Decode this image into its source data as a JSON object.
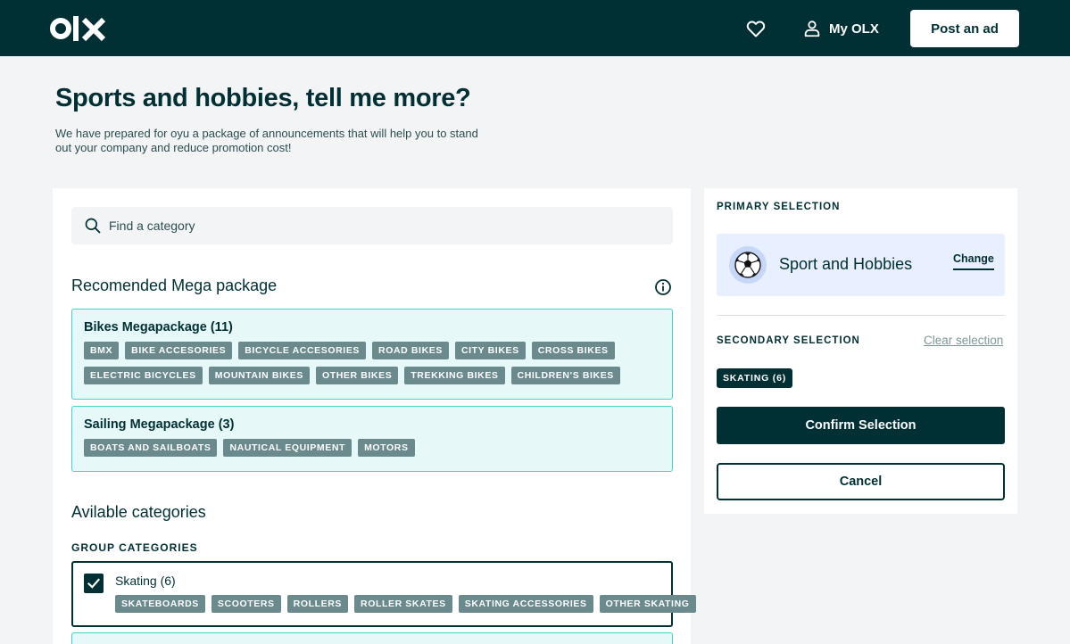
{
  "header": {
    "logo_text": "olx",
    "my_olx_label": "My OLX",
    "post_ad_label": "Post an ad"
  },
  "page": {
    "title": "Sports and hobbies, tell me more?",
    "subtitle": "We have prepared for oyu a package of announcements that will help you to stand out your company and reduce promotion cost!"
  },
  "search": {
    "placeholder": "Find a category"
  },
  "recommended": {
    "title": "Recomended Mega package",
    "packages": [
      {
        "title": "Bikes Megapackage (11)",
        "tags": [
          "BMX",
          "BIKE ACCESORIES",
          "BICYCLE ACCESORIES",
          "ROAD BIKES",
          "CITY BIKES",
          "CROSS BIKES",
          "ELECTRIC BICYCLES",
          "MOUNTAIN BIKES",
          "OTHER BIKES",
          "TREKKING BIKES",
          "CHILDREN'S BIKES"
        ]
      },
      {
        "title": "Sailing Megapackage (3)",
        "tags": [
          "BOATS AND SAILBOATS",
          "NAUTICAL EQUIPMENT",
          "MOTORS"
        ]
      }
    ]
  },
  "available": {
    "title": "Avilable categories",
    "group_label": "GROUP CATEGORIES",
    "groups": [
      {
        "name": "Skating (6)",
        "checked": true,
        "tags": [
          "SKATEBOARDS",
          "SCOOTERS",
          "ROLLERS",
          "ROLLER SKATES",
          "SKATING ACCESSORIES",
          "OTHER SKATING"
        ]
      }
    ]
  },
  "selection": {
    "primary_label": "PRIMARY SELECTION",
    "primary_name": "Sport and Hobbies",
    "change_label": "Change",
    "secondary_label": "SECONDARY SELECTION",
    "clear_label": "Clear selection",
    "selected_chip": "SKATING (6)",
    "confirm_label": "Confirm Selection",
    "cancel_label": "Cancel"
  },
  "colors": {
    "brand_dark": "#002f34",
    "package_bg": "#e6f8f7",
    "package_border": "#3dd6c8",
    "tag_bg": "#6b8a8d",
    "primary_box_bg": "#e8effe"
  },
  "icons": {
    "favorites": "heart-icon",
    "account": "user-icon",
    "search": "search-icon",
    "info": "info-icon",
    "check": "check-icon",
    "category": "soccer-ball-icon"
  }
}
